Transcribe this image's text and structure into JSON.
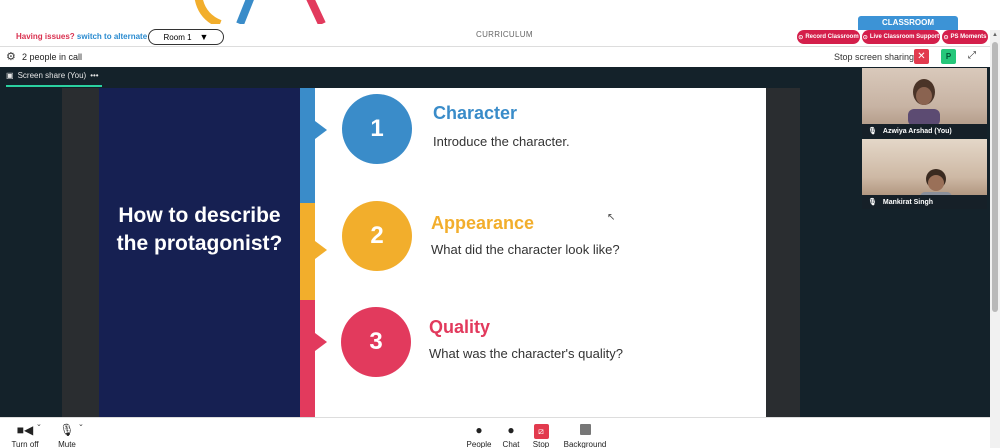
{
  "topbar": {
    "issues_text": "Having issues?",
    "alternate_link": "switch to alternate room",
    "room_label": "Room 1",
    "curriculum_label": "CURRICULUM",
    "classroom_tab": "CLASSROOM",
    "record_label": "Record Classroom",
    "support_label": "Live Classroom Support",
    "moments_label": "PS Moments"
  },
  "callbar": {
    "people_count": "2 people in call",
    "stop_sharing_label": "Stop screen sharing",
    "close_glyph": "✕",
    "p_badge": "P"
  },
  "stage": {
    "share_tab_label": "Screen share (You)",
    "share_menu_glyph": "•••"
  },
  "slide": {
    "title": "How to describe the protagonist?",
    "items": [
      {
        "number": "1",
        "heading": "Character",
        "description": "Introduce the character.",
        "color": "#3a8cc9"
      },
      {
        "number": "2",
        "heading": "Appearance",
        "description": "What did the character look like?",
        "color": "#f2ae2c"
      },
      {
        "number": "3",
        "heading": "Quality",
        "description": "What was the character's quality?",
        "color": "#e23a5d"
      }
    ]
  },
  "participants": [
    {
      "name": "Azwiya Arshad (You)"
    },
    {
      "name": "Mankirat Singh"
    }
  ],
  "toolbar": {
    "turn_off_label": "Turn off",
    "mute_label": "Mute",
    "people_label": "People",
    "chat_label": "Chat",
    "stop_label": "Stop",
    "background_label": "Background"
  },
  "icons": {
    "settings": "gear-icon",
    "camera": "video-camera-icon",
    "mic": "microphone-icon",
    "people": "person-icon",
    "chat": "chat-bubble-icon",
    "stop": "stop-share-icon",
    "background": "background-icon"
  },
  "colors": {
    "accent_red": "#d41f4b",
    "accent_blue": "#3c93d6",
    "stage_dark": "#14222a",
    "slide_navy": "#162052",
    "share_underline": "#2bd1a0"
  }
}
